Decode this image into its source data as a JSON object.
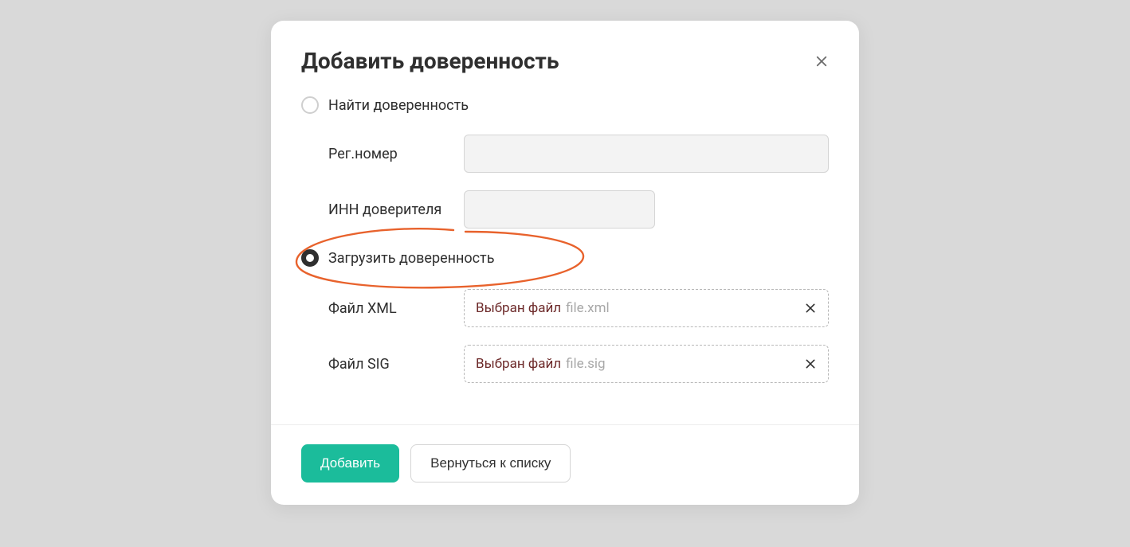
{
  "modal": {
    "title": "Добавить доверенность"
  },
  "radios": {
    "find_label": "Найти доверенность",
    "upload_label": "Загрузить доверенность"
  },
  "fields": {
    "reg_number_label": "Рег.номер",
    "reg_number_value": "",
    "inn_label": "ИНН доверителя",
    "inn_value": "",
    "file_xml_label": "Файл XML",
    "file_sig_label": "Файл SIG",
    "file_selected_prefix": "Выбран файл",
    "file_xml_name": "file.xml",
    "file_sig_name": "file.sig"
  },
  "footer": {
    "submit_label": "Добавить",
    "back_label": "Вернуться к списку"
  },
  "colors": {
    "accent": "#1bbc9b",
    "highlight": "#e8622c"
  }
}
